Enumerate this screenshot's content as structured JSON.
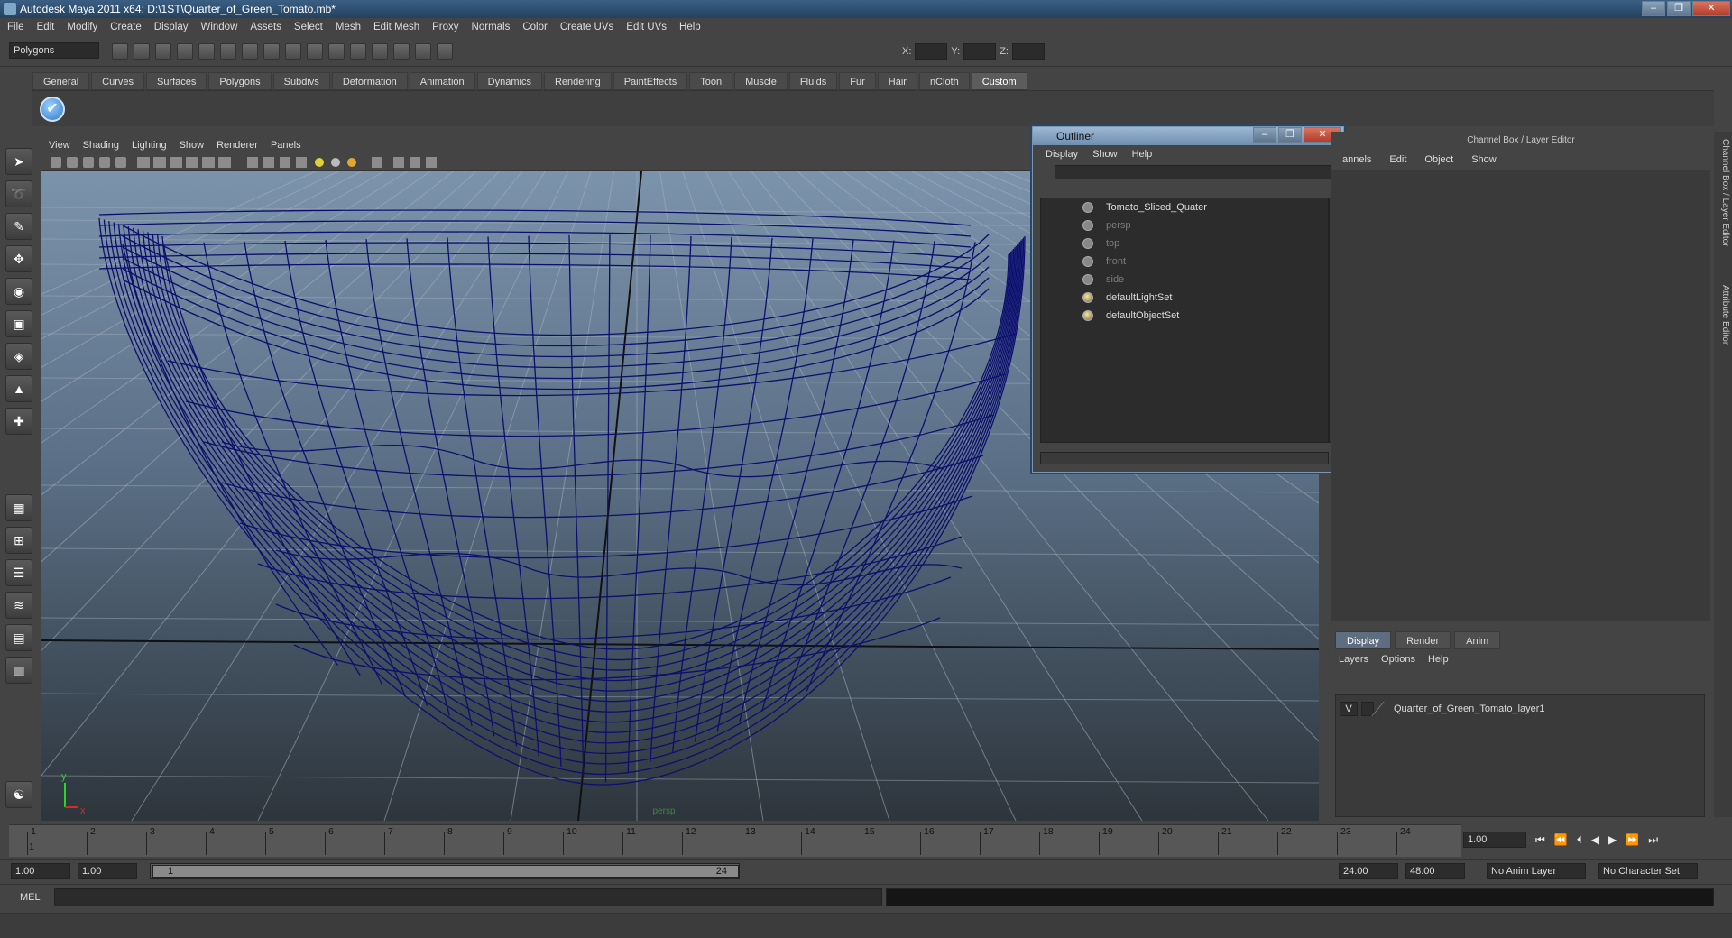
{
  "window": {
    "title": "Autodesk Maya 2011 x64: D:\\1ST\\Quarter_of_Green_Tomato.mb*",
    "controls": [
      "‒",
      "❐",
      "✕"
    ]
  },
  "menubar": [
    "File",
    "Edit",
    "Modify",
    "Create",
    "Display",
    "Window",
    "Assets",
    "Select",
    "Mesh",
    "Edit Mesh",
    "Proxy",
    "Normals",
    "Color",
    "Create UVs",
    "Edit UVs",
    "Help"
  ],
  "toolbar": {
    "mode": "Polygons",
    "x_label": "X:",
    "y_label": "Y:",
    "z_label": "Z:"
  },
  "shelf": {
    "tabs": [
      "General",
      "Curves",
      "Surfaces",
      "Polygons",
      "Subdivs",
      "Deformation",
      "Animation",
      "Dynamics",
      "Rendering",
      "PaintEffects",
      "Toon",
      "Muscle",
      "Fluids",
      "Fur",
      "Hair",
      "nCloth",
      "Custom"
    ],
    "active_tab": "Custom",
    "icon": "check-icon"
  },
  "viewport": {
    "menu": [
      "View",
      "Shading",
      "Lighting",
      "Show",
      "Renderer",
      "Panels"
    ],
    "camera_label": "persp",
    "axis_y": "y",
    "axis_x": "x"
  },
  "outliner": {
    "title": "Outliner",
    "menu": [
      "Display",
      "Show",
      "Help"
    ],
    "items": [
      {
        "label": "Tomato_Sliced_Quater",
        "dim": false,
        "icon": "mesh-icon"
      },
      {
        "label": "persp",
        "dim": true,
        "icon": "camera-icon"
      },
      {
        "label": "top",
        "dim": true,
        "icon": "camera-icon"
      },
      {
        "label": "front",
        "dim": true,
        "icon": "camera-icon"
      },
      {
        "label": "side",
        "dim": true,
        "icon": "camera-icon"
      },
      {
        "label": "defaultLightSet",
        "dim": false,
        "icon": "set-icon"
      },
      {
        "label": "defaultObjectSet",
        "dim": false,
        "icon": "set-icon"
      }
    ]
  },
  "channelbox": {
    "header": "Channel Box / Layer Editor",
    "menu": [
      "annels",
      "Edit",
      "Object",
      "Show"
    ]
  },
  "layers": {
    "tabs": [
      "Display",
      "Render",
      "Anim"
    ],
    "active_tab": "Display",
    "menu": [
      "Layers",
      "Options",
      "Help"
    ],
    "row": {
      "visible": "V",
      "name": "Quarter_of_Green_Tomato_layer1"
    }
  },
  "side_tabs": [
    "Channel Box / Layer Editor",
    "Attribute Editor"
  ],
  "timeline": {
    "frames": [
      "1",
      "2",
      "3",
      "4",
      "5",
      "6",
      "7",
      "8",
      "9",
      "10",
      "11",
      "12",
      "13",
      "14",
      "15",
      "16",
      "17",
      "18",
      "19",
      "20",
      "21",
      "22",
      "23",
      "24"
    ],
    "current_marker": "1",
    "current_frame": "1.00"
  },
  "range": {
    "start": "1.00",
    "playback_start": "1.00",
    "slider_start": "1",
    "slider_end": "24",
    "playback_end": "24.00",
    "end": "48.00",
    "anim_layer": "No Anim Layer",
    "character_set": "No Character Set"
  },
  "command": {
    "label": "MEL"
  },
  "colors": {
    "wire": "#0c0f6e",
    "grid": "#a7b3bf",
    "accent": "#5e6e80"
  }
}
